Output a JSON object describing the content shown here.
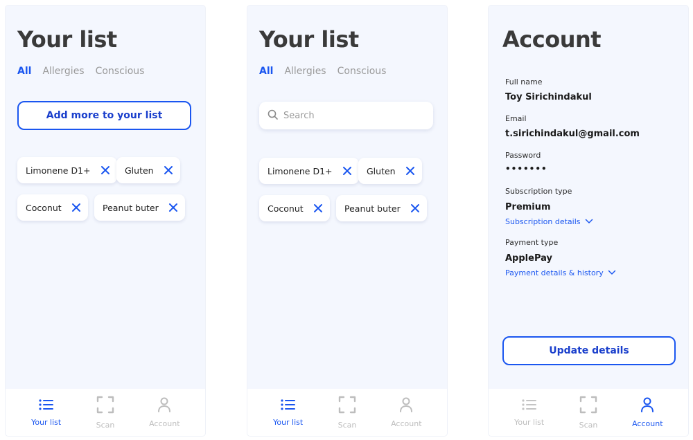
{
  "list_screens": [
    {
      "title": "Your list",
      "tabs": [
        "All",
        "Allergies",
        "Conscious"
      ],
      "add_button": "Add more to your list",
      "chips": [
        "Limonene D1+",
        "Gluten",
        "Coconut",
        "Peanut buter"
      ]
    },
    {
      "title": "Your list",
      "tabs": [
        "All",
        "Allergies",
        "Conscious"
      ],
      "search": {
        "placeholder": "Search"
      },
      "chips": [
        "Limonene D1+",
        "Gluten",
        "Coconut",
        "Peanut buter"
      ]
    }
  ],
  "account": {
    "title": "Account",
    "full_name_label": "Full name",
    "full_name": "Toy Sirichindakul",
    "email_label": "Email",
    "email": "t.sirichindakul@gmail.com",
    "password_label": "Password",
    "password": "•••••••",
    "subscription_label": "Subscription type",
    "subscription": "Premium",
    "subscription_link": "Subscription details",
    "payment_label": "Payment type",
    "payment": "ApplePay",
    "payment_link": "Payment details & history",
    "update_button": "Update details"
  },
  "nav": {
    "your_list": "Your list",
    "scan": "Scan",
    "account": "Account"
  },
  "colors": {
    "accent": "#1a56f0",
    "screen_bg": "#f4f7fe",
    "inactive": "#bdbdbd"
  }
}
